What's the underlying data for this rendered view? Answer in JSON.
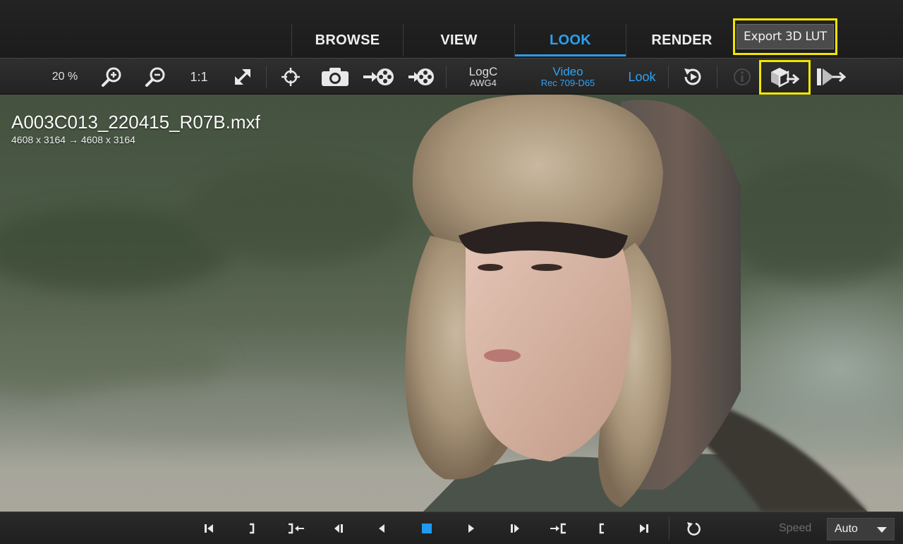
{
  "tabs": [
    {
      "label": "BROWSE",
      "active": false
    },
    {
      "label": "VIEW",
      "active": false
    },
    {
      "label": "LOOK",
      "active": true
    },
    {
      "label": "RENDER",
      "active": false
    }
  ],
  "tooltip": "Export 3D LUT",
  "toolbar": {
    "zoom_level": "20 %",
    "one_to_one": "1:1",
    "input_color_line1": "LogC",
    "input_color_line2": "AWG4",
    "output_color_line1": "Video",
    "output_color_line2": "Rec 709-D65",
    "look_label": "Look"
  },
  "viewer": {
    "filename": "A003C013_220415_R07B.mxf",
    "resolution": "4608 x 3164  → 4608 x 3164"
  },
  "transport": {
    "speed_label": "Speed",
    "speed_value": "Auto"
  },
  "colors": {
    "accent_blue": "#2ba0f0",
    "highlight_yellow": "#f2e600",
    "background": "#1b1b1b"
  },
  "icons": [
    "zoom-in-icon",
    "zoom-out-icon",
    "fit-icon",
    "crosshair-icon",
    "camera-icon",
    "export-frame-icon",
    "import-frame-icon",
    "reset-look-icon",
    "info-icon",
    "export-3d-lut-icon",
    "export-look-icon",
    "loop-icon"
  ]
}
